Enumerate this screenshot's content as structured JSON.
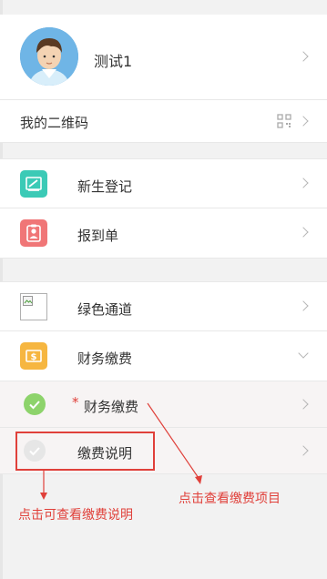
{
  "profile": {
    "name": "测试1"
  },
  "qrcode": {
    "label": "我的二维码"
  },
  "menu1": [
    {
      "label": "新生登记"
    },
    {
      "label": "报到单"
    }
  ],
  "menu2": {
    "green_channel": {
      "label": "绿色通道"
    },
    "finance": {
      "label": "财务缴费"
    },
    "finance_sub": {
      "star": "*",
      "label": "财务缴费"
    },
    "fee_explain": {
      "label": "缴费说明"
    }
  },
  "annotations": {
    "view_items": "点击查看缴费项目",
    "view_explain": "点击可查看缴费说明"
  },
  "colors": {
    "teal": "#3bcab6",
    "pink": "#f07677",
    "orange": "#f6b640",
    "green_check": "#8dd36b",
    "annotation_red": "#e0403a"
  }
}
